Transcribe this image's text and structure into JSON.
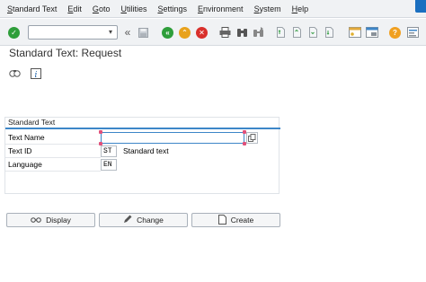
{
  "menu": [
    {
      "label": "Standard Text",
      "mnemonic": "S",
      "rest": "tandard Text"
    },
    {
      "label": "Edit",
      "mnemonic": "E",
      "rest": "dit"
    },
    {
      "label": "Goto",
      "mnemonic": "G",
      "rest": "oto"
    },
    {
      "label": "Utilities",
      "mnemonic": "U",
      "rest": "tilities"
    },
    {
      "label": "Settings",
      "mnemonic": "S",
      "rest": "ettings"
    },
    {
      "label": "Environment",
      "mnemonic": "E",
      "rest": "nvironment"
    },
    {
      "label": "System",
      "mnemonic": "S",
      "rest": "ystem"
    },
    {
      "label": "Help",
      "mnemonic": "H",
      "rest": "elp"
    }
  ],
  "command_field": {
    "value": ""
  },
  "page_title": "Standard Text: Request",
  "group": {
    "title": "Standard Text",
    "rows": [
      {
        "label": "Text Name",
        "value": ""
      },
      {
        "label": "Text ID",
        "value": "ST",
        "description": "Standard text"
      },
      {
        "label": "Language",
        "value": "EN"
      }
    ]
  },
  "buttons": {
    "display": "Display",
    "change": "Change",
    "create": "Create"
  },
  "colors": {
    "accent_blue": "#3d86c8",
    "ok_green": "#2e9e3a",
    "nav_green": "#2e9e3a",
    "exit_orange": "#e8a21c",
    "cancel_red": "#d9302c",
    "help_orange": "#f0a020"
  },
  "icons": {
    "enter": "check-circle-icon",
    "back": "back-icon",
    "exit": "up-arrow-icon",
    "cancel": "cancel-icon",
    "print": "printer-icon",
    "find": "binoculars-icon",
    "help": "question-icon"
  }
}
